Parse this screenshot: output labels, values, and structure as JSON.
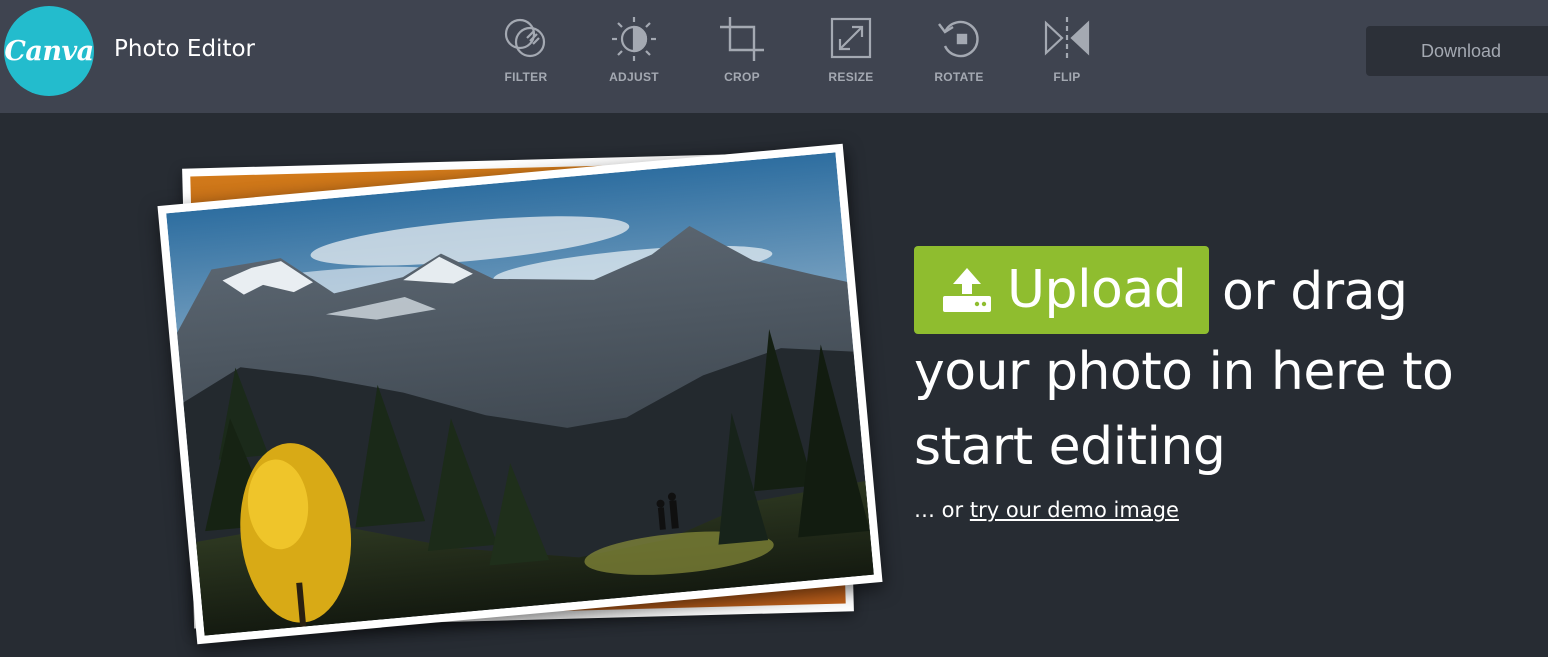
{
  "header": {
    "logo_text": "Canva",
    "app_title": "Photo Editor",
    "download_label": "Download"
  },
  "toolbar": [
    {
      "id": "filter",
      "label": "FILTER",
      "icon": "filter-icon"
    },
    {
      "id": "adjust",
      "label": "ADJUST",
      "icon": "adjust-icon"
    },
    {
      "id": "crop",
      "label": "CROP",
      "icon": "crop-icon"
    },
    {
      "id": "resize",
      "label": "RESIZE",
      "icon": "resize-icon"
    },
    {
      "id": "rotate",
      "label": "ROTATE",
      "icon": "rotate-icon"
    },
    {
      "id": "flip",
      "label": "FLIP",
      "icon": "flip-icon"
    }
  ],
  "main": {
    "upload_label": "Upload",
    "line1_rest": "or drag",
    "line2": "your photo in here to",
    "line3": "start editing",
    "demo_prefix": "… or ",
    "demo_link": "try our demo image"
  },
  "colors": {
    "topbar": "#3f4450",
    "background": "#272c33",
    "logo": "#23bccd",
    "upload_button": "#8fbd2f",
    "toolbar_icon": "#a4a9b2"
  }
}
